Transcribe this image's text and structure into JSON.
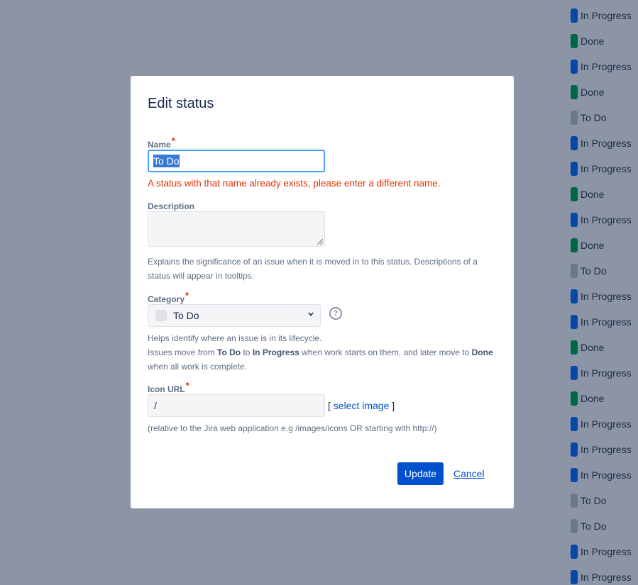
{
  "colors": {
    "in_progress": "#0747a6",
    "done": "#006644",
    "todo": "#6b778c",
    "primary": "#0052cc",
    "error": "#de350b"
  },
  "background_statuses": [
    {
      "label": "In Progress",
      "category": "in_progress"
    },
    {
      "label": "Done",
      "category": "done"
    },
    {
      "label": "In Progress",
      "category": "in_progress"
    },
    {
      "label": "Done",
      "category": "done"
    },
    {
      "label": "To Do",
      "category": "todo"
    },
    {
      "label": "In Progress",
      "category": "in_progress"
    },
    {
      "label": "In Progress",
      "category": "in_progress"
    },
    {
      "label": "Done",
      "category": "done"
    },
    {
      "label": "In Progress",
      "category": "in_progress"
    },
    {
      "label": "Done",
      "category": "done"
    },
    {
      "label": "To Do",
      "category": "todo"
    },
    {
      "label": "In Progress",
      "category": "in_progress"
    },
    {
      "label": "In Progress",
      "category": "in_progress"
    },
    {
      "label": "Done",
      "category": "done"
    },
    {
      "label": "In Progress",
      "category": "in_progress"
    },
    {
      "label": "Done",
      "category": "done"
    },
    {
      "label": "In Progress",
      "category": "in_progress"
    },
    {
      "label": "In Progress",
      "category": "in_progress"
    },
    {
      "label": "In Progress",
      "category": "in_progress"
    },
    {
      "label": "To Do",
      "category": "todo"
    },
    {
      "label": "To Do",
      "category": "todo"
    },
    {
      "label": "In Progress",
      "category": "in_progress"
    },
    {
      "label": "In Progress",
      "category": "in_progress"
    }
  ],
  "dialog": {
    "title": "Edit status",
    "required_mark": "*",
    "name": {
      "label": "Name",
      "value": "To Do",
      "error": "A status with that name already exists, please enter a different name."
    },
    "description": {
      "label": "Description",
      "value": "",
      "help": "Explains the significance of an issue when it is moved in to this status. Descriptions of a status will appear in tooltips."
    },
    "category": {
      "label": "Category",
      "selected": "To Do",
      "help_line1": "Helps identify where an issue is in its lifecycle.",
      "help_line2_a": "Issues move from ",
      "help_line2_todo": "To Do",
      "help_line2_b": " to ",
      "help_line2_inprogress": "In Progress",
      "help_line2_c": " when work starts on them, and later move to ",
      "help_line2_done": "Done",
      "help_line3": "when all work is complete.",
      "help_icon": "?"
    },
    "icon_url": {
      "label": "Icon URL",
      "value": "/",
      "select_open": "[ ",
      "select_link": "select image",
      "select_close": " ]",
      "help": "(relative to the Jira web application e.g /images/icons OR starting with http://)"
    },
    "update_label": "Update",
    "cancel_label": "Cancel"
  }
}
